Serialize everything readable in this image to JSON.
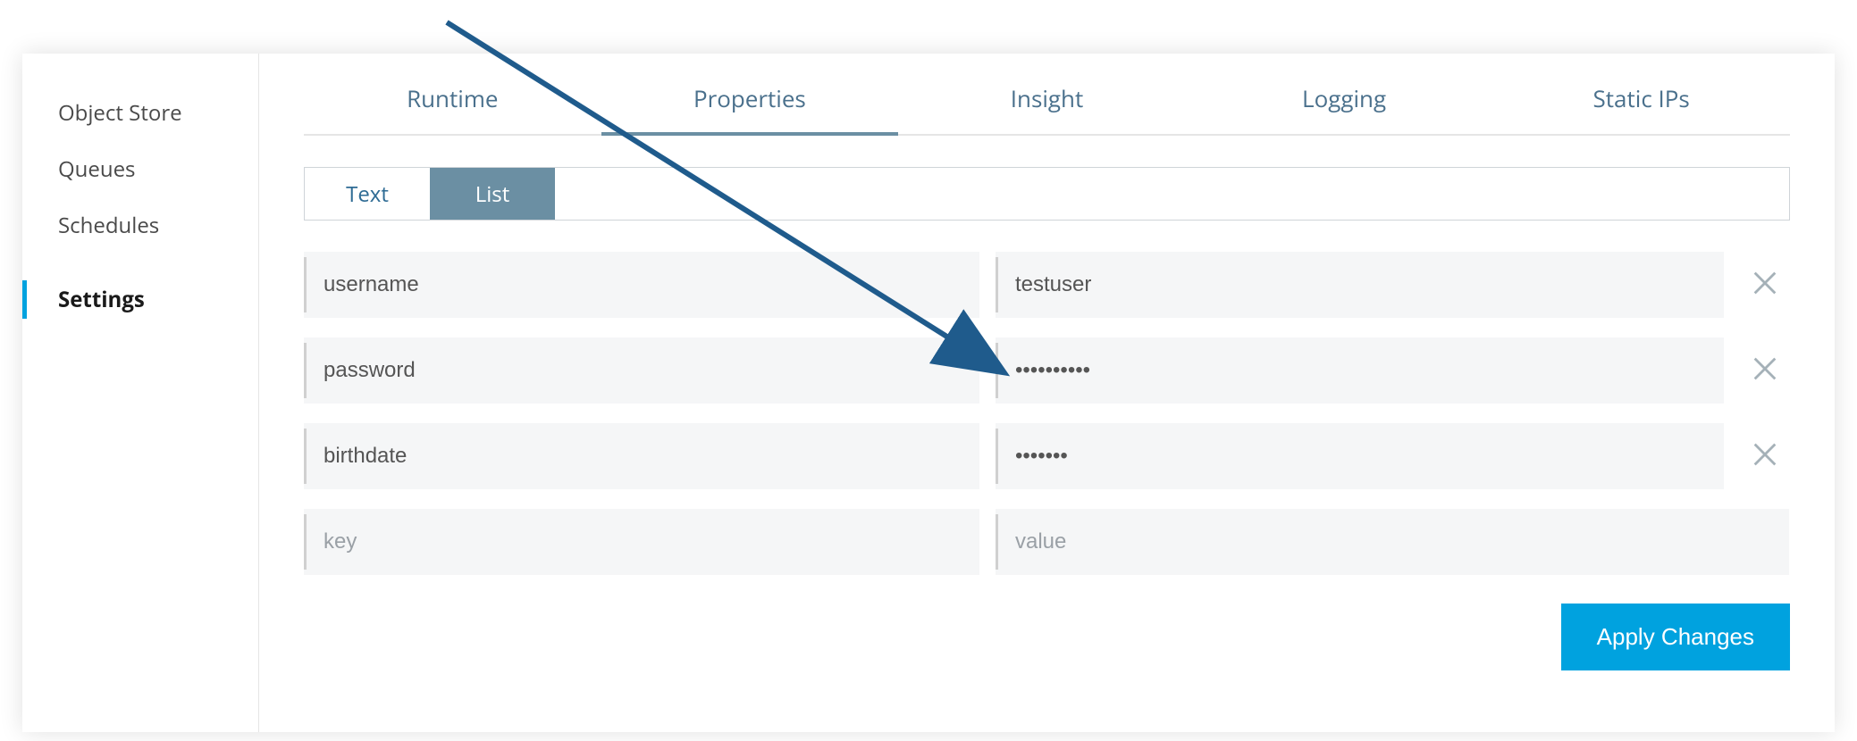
{
  "sidebar": {
    "items": [
      {
        "label": "Object Store"
      },
      {
        "label": "Queues"
      },
      {
        "label": "Schedules"
      },
      {
        "label": "Settings"
      }
    ]
  },
  "tabs": [
    {
      "label": "Runtime"
    },
    {
      "label": "Properties"
    },
    {
      "label": "Insight"
    },
    {
      "label": "Logging"
    },
    {
      "label": "Static IPs"
    }
  ],
  "view_toggle": {
    "text_label": "Text",
    "list_label": "List"
  },
  "rows": [
    {
      "key": "username",
      "value": "testuser"
    },
    {
      "key": "password",
      "value": "••••••••••"
    },
    {
      "key": "birthdate",
      "value": "•••••••"
    }
  ],
  "empty_row": {
    "key_placeholder": "key",
    "value_placeholder": "value"
  },
  "apply_label": "Apply Changes",
  "colors": {
    "accent": "#00a2df",
    "tab_underline": "#6b8fa3",
    "arrow": "#1f5b8c"
  }
}
